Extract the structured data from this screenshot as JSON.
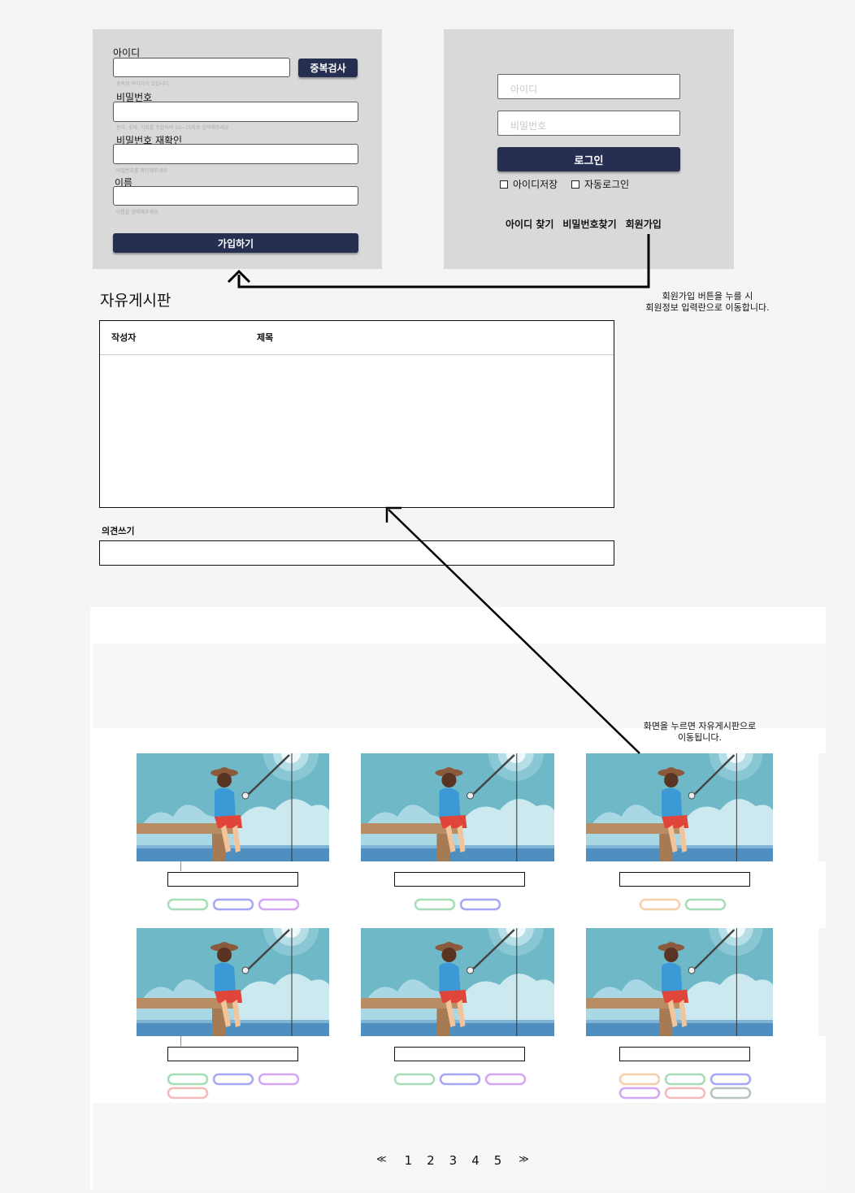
{
  "signup": {
    "id_label": "아이디",
    "dup_check_button": "중복검사",
    "id_hint": "중복된 아이디가 있습니다",
    "pw_label": "비밀번호",
    "pw_hint": "문자, 숫자, 기호를 조합하여 10~15자로 입력해주세요",
    "pw_confirm_label": "비밀번호 재확인",
    "pw_confirm_hint": "비밀번호를 확인해주세요",
    "name_label": "이름",
    "name_hint": "이름을 입력해주세요",
    "submit_button": "가입하기"
  },
  "login": {
    "id_placeholder": "아이디",
    "pw_placeholder": "비밀번호",
    "login_button": "로그인",
    "save_id_label": "아이디저장",
    "auto_login_label": "자동로그인",
    "find_id_link": "아이디 찾기",
    "find_pw_link": "비밀번호찾기",
    "signup_link": "회원가입"
  },
  "annotations": {
    "signup_note_line1": "회원가입 버튼을 누를 시",
    "signup_note_line2": "회원정보 입력란으로 이동합니다.",
    "gallery_note_line1": "화면을 누르면 자유게시판으로",
    "gallery_note_line2": "이동됩니다."
  },
  "board": {
    "title": "자유게시판",
    "col_author": "작성자",
    "col_subject": "제목",
    "comment_label": "의견쓰기"
  },
  "gallery": {
    "illustration": "fisherman-on-pier",
    "tag_colors": {
      "green": "#8fd4a4",
      "blue": "#8f8ff2",
      "purple": "#c98ff0",
      "orange": "#f2c494",
      "salmon": "#f0a8a8",
      "gray": "#a8b4a8"
    },
    "cards": [
      {
        "tags": [
          "green",
          "blue",
          "purple"
        ]
      },
      {
        "tags": [
          "green",
          "blue"
        ]
      },
      {
        "tags": [
          "orange",
          "green"
        ]
      },
      {
        "tags": [
          "green",
          "blue",
          "purple",
          "salmon"
        ]
      },
      {
        "tags": [
          "green",
          "blue",
          "purple"
        ]
      },
      {
        "tags": [
          "orange",
          "green",
          "blue",
          "purple",
          "salmon",
          "gray"
        ]
      }
    ]
  },
  "pagination": {
    "prev": "≪",
    "pages": [
      "1",
      "2",
      "3",
      "4",
      "5"
    ],
    "next": "≫"
  },
  "colors": {
    "navy": "#262f52",
    "panel_gray": "#d9d9d9"
  }
}
